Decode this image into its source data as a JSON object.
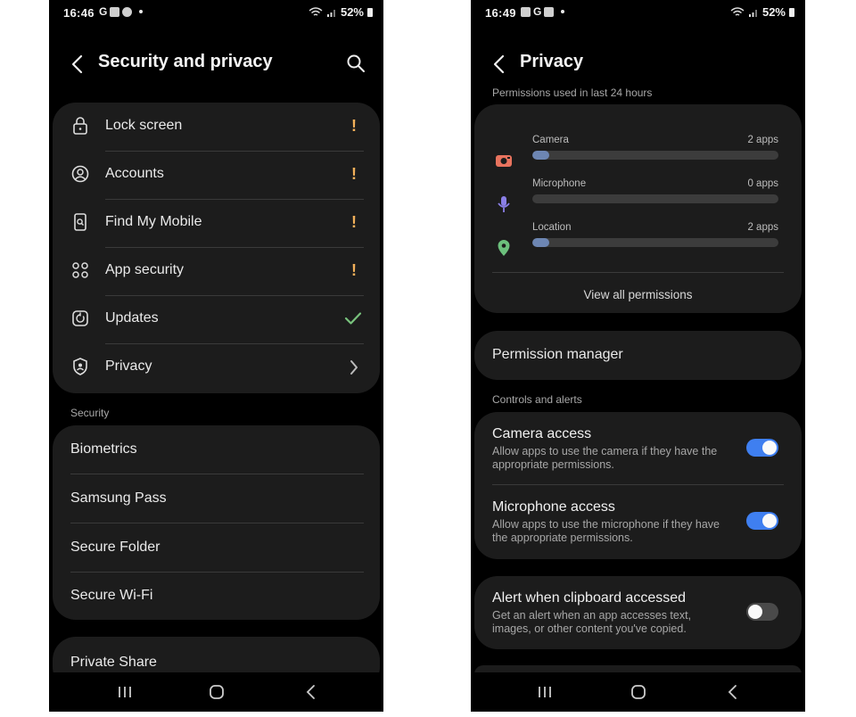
{
  "left": {
    "status": {
      "time": "16:46",
      "battery": "52%"
    },
    "title": "Security and privacy",
    "items": [
      {
        "label": "Lock screen",
        "icon": "lock-icon",
        "status": "warning"
      },
      {
        "label": "Accounts",
        "icon": "account-circle-icon",
        "status": "warning"
      },
      {
        "label": "Find My Mobile",
        "icon": "find-mobile-icon",
        "status": "warning"
      },
      {
        "label": "App security",
        "icon": "app-grid-icon",
        "status": "warning"
      },
      {
        "label": "Updates",
        "icon": "update-icon",
        "status": "ok"
      },
      {
        "label": "Privacy",
        "icon": "privacy-shield-icon",
        "status": "chevron"
      }
    ],
    "warning_mark": "!",
    "security_header": "Security",
    "security_items": [
      "Biometrics",
      "Samsung Pass",
      "Secure Folder",
      "Secure Wi-Fi"
    ],
    "private_share": "Private Share"
  },
  "right": {
    "status": {
      "time": "16:49",
      "battery": "52%"
    },
    "title": "Privacy",
    "used_header": "Permissions used in last 24 hours",
    "permissions": [
      {
        "name": "Camera",
        "count": "2 apps",
        "usage": 0.07,
        "color": "#e8735e",
        "icon": "camera-icon"
      },
      {
        "name": "Microphone",
        "count": "0 apps",
        "usage": 0,
        "color": "#8a7fe6",
        "icon": "microphone-icon"
      },
      {
        "name": "Location",
        "count": "2 apps",
        "usage": 0.07,
        "color": "#6cc07c",
        "icon": "location-pin-icon"
      }
    ],
    "view_all": "View all permissions",
    "permission_manager": "Permission manager",
    "controls_header": "Controls and alerts",
    "toggles": [
      {
        "title": "Camera access",
        "desc": "Allow apps to use the camera if they have the appropriate permissions.",
        "on": true
      },
      {
        "title": "Microphone access",
        "desc": "Allow apps to use the microphone if they have the appropriate permissions.",
        "on": true
      }
    ],
    "clipboard": {
      "title": "Alert when clipboard accessed",
      "desc": "Get an alert when an app accesses text, images, or other content you've copied.",
      "on": false
    }
  },
  "colors": {
    "warning": "#f2b05a",
    "ok": "#78c27c",
    "accent": "#3f7ff0"
  }
}
